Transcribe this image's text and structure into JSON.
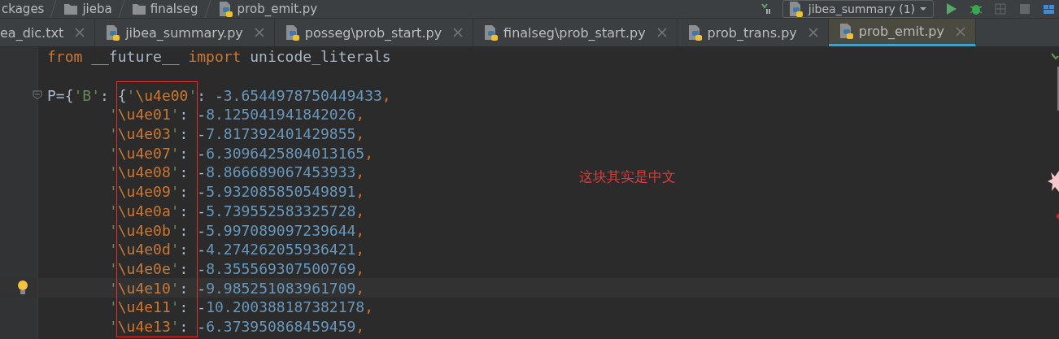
{
  "breadcrumbs": [
    {
      "label": "ckages",
      "kind": "plain"
    },
    {
      "label": "jieba",
      "kind": "folder"
    },
    {
      "label": "finalseg",
      "kind": "folder"
    },
    {
      "label": "prob_emit.py",
      "kind": "file"
    }
  ],
  "run_config": {
    "label": "jibea_summary (1)"
  },
  "tabs": [
    {
      "label": "ea_dic.txt",
      "kind": "plain",
      "selected": false
    },
    {
      "label": "jibea_summary.py",
      "kind": "file",
      "selected": false
    },
    {
      "label": "posseg\\prob_start.py",
      "kind": "file",
      "selected": false
    },
    {
      "label": "finalseg\\prob_start.py",
      "kind": "file",
      "selected": false
    },
    {
      "label": "prob_trans.py",
      "kind": "file",
      "selected": false
    },
    {
      "label": "prob_emit.py",
      "kind": "file",
      "selected": true
    }
  ],
  "code_lines": [
    {
      "kind": "top",
      "current": false,
      "foldable": false,
      "tokens": [
        {
          "kind": "kw",
          "text": "from"
        },
        {
          "kind": "plain",
          "text": " __future__ "
        },
        {
          "kind": "kw",
          "text": "import"
        },
        {
          "kind": "plain",
          "text": " unicode_literals"
        }
      ]
    },
    {
      "kind": "blank",
      "current": false,
      "foldable": false
    },
    {
      "kind": "top",
      "current": false,
      "foldable": true,
      "tokens": [
        {
          "kind": "plain",
          "text": "P={"
        },
        {
          "kind": "str",
          "text": "'B'"
        },
        {
          "kind": "plain",
          "text": ": {"
        },
        {
          "kind": "str",
          "text": "'"
        },
        {
          "kind": "esc",
          "text": "\\u4e00"
        },
        {
          "kind": "str",
          "text": "'"
        },
        {
          "kind": "plain",
          "text": ": -"
        },
        {
          "kind": "num",
          "text": "3.6544978750449433"
        },
        {
          "kind": "kw",
          "text": ","
        }
      ]
    },
    {
      "kind": "entry",
      "current": false,
      "foldable": false,
      "tokens": [
        {
          "kind": "str",
          "text": "'"
        },
        {
          "kind": "esc",
          "text": "\\u4e01"
        },
        {
          "kind": "str",
          "text": "'"
        },
        {
          "kind": "plain",
          "text": ": -"
        },
        {
          "kind": "num",
          "text": "8.125041941842026"
        },
        {
          "kind": "kw",
          "text": ","
        }
      ]
    },
    {
      "kind": "entry",
      "current": false,
      "foldable": false,
      "tokens": [
        {
          "kind": "str",
          "text": "'"
        },
        {
          "kind": "esc",
          "text": "\\u4e03"
        },
        {
          "kind": "str",
          "text": "'"
        },
        {
          "kind": "plain",
          "text": ": -"
        },
        {
          "kind": "num",
          "text": "7.817392401429855"
        },
        {
          "kind": "kw",
          "text": ","
        }
      ]
    },
    {
      "kind": "entry",
      "current": false,
      "foldable": false,
      "tokens": [
        {
          "kind": "str",
          "text": "'"
        },
        {
          "kind": "esc",
          "text": "\\u4e07"
        },
        {
          "kind": "str",
          "text": "'"
        },
        {
          "kind": "plain",
          "text": ": -"
        },
        {
          "kind": "num",
          "text": "6.3096425804013165"
        },
        {
          "kind": "kw",
          "text": ","
        }
      ]
    },
    {
      "kind": "entry",
      "current": false,
      "foldable": false,
      "tokens": [
        {
          "kind": "str",
          "text": "'"
        },
        {
          "kind": "esc",
          "text": "\\u4e08"
        },
        {
          "kind": "str",
          "text": "'"
        },
        {
          "kind": "plain",
          "text": ": -"
        },
        {
          "kind": "num",
          "text": "8.866689067453933"
        },
        {
          "kind": "kw",
          "text": ","
        }
      ]
    },
    {
      "kind": "entry",
      "current": false,
      "foldable": false,
      "tokens": [
        {
          "kind": "str",
          "text": "'"
        },
        {
          "kind": "esc",
          "text": "\\u4e09"
        },
        {
          "kind": "str",
          "text": "'"
        },
        {
          "kind": "plain",
          "text": ": -"
        },
        {
          "kind": "num",
          "text": "5.932085850549891"
        },
        {
          "kind": "kw",
          "text": ","
        }
      ]
    },
    {
      "kind": "entry",
      "current": false,
      "foldable": false,
      "tokens": [
        {
          "kind": "str",
          "text": "'"
        },
        {
          "kind": "esc",
          "text": "\\u4e0a"
        },
        {
          "kind": "str",
          "text": "'"
        },
        {
          "kind": "plain",
          "text": ": -"
        },
        {
          "kind": "num",
          "text": "5.739552583325728"
        },
        {
          "kind": "kw",
          "text": ","
        }
      ]
    },
    {
      "kind": "entry",
      "current": false,
      "foldable": false,
      "tokens": [
        {
          "kind": "str",
          "text": "'"
        },
        {
          "kind": "esc",
          "text": "\\u4e0b"
        },
        {
          "kind": "str",
          "text": "'"
        },
        {
          "kind": "plain",
          "text": ": -"
        },
        {
          "kind": "num",
          "text": "5.997089097239644"
        },
        {
          "kind": "kw",
          "text": ","
        }
      ]
    },
    {
      "kind": "entry",
      "current": false,
      "foldable": false,
      "tokens": [
        {
          "kind": "str",
          "text": "'"
        },
        {
          "kind": "esc",
          "text": "\\u4e0d"
        },
        {
          "kind": "str",
          "text": "'"
        },
        {
          "kind": "plain",
          "text": ": -"
        },
        {
          "kind": "num",
          "text": "4.274262055936421"
        },
        {
          "kind": "kw",
          "text": ","
        }
      ]
    },
    {
      "kind": "entry",
      "current": false,
      "foldable": false,
      "tokens": [
        {
          "kind": "str",
          "text": "'"
        },
        {
          "kind": "esc",
          "text": "\\u4e0e"
        },
        {
          "kind": "str",
          "text": "'"
        },
        {
          "kind": "plain",
          "text": ": -"
        },
        {
          "kind": "num",
          "text": "8.355569307500769"
        },
        {
          "kind": "kw",
          "text": ","
        }
      ]
    },
    {
      "kind": "entry",
      "current": true,
      "foldable": false,
      "tokens": [
        {
          "kind": "str",
          "text": "'"
        },
        {
          "kind": "esc",
          "text": "\\u4e10"
        },
        {
          "kind": "str",
          "text": "'"
        },
        {
          "kind": "plain",
          "text": ": -"
        },
        {
          "kind": "num",
          "text": "9.985251083961709"
        },
        {
          "kind": "kw",
          "text": ","
        }
      ]
    },
    {
      "kind": "entry",
      "current": false,
      "foldable": false,
      "tokens": [
        {
          "kind": "str",
          "text": "'"
        },
        {
          "kind": "esc",
          "text": "\\u4e11"
        },
        {
          "kind": "str",
          "text": "'"
        },
        {
          "kind": "plain",
          "text": ": -"
        },
        {
          "kind": "num",
          "text": "10.200388187382178"
        },
        {
          "kind": "kw",
          "text": ","
        }
      ]
    },
    {
      "kind": "entry",
      "current": false,
      "foldable": false,
      "tokens": [
        {
          "kind": "str",
          "text": "'"
        },
        {
          "kind": "esc",
          "text": "\\u4e13"
        },
        {
          "kind": "str",
          "text": "'"
        },
        {
          "kind": "plain",
          "text": ": -"
        },
        {
          "kind": "num",
          "text": "6.373950868459459"
        },
        {
          "kind": "kw",
          "text": ","
        }
      ]
    }
  ],
  "annotation": {
    "text": "这块其实是中文"
  }
}
